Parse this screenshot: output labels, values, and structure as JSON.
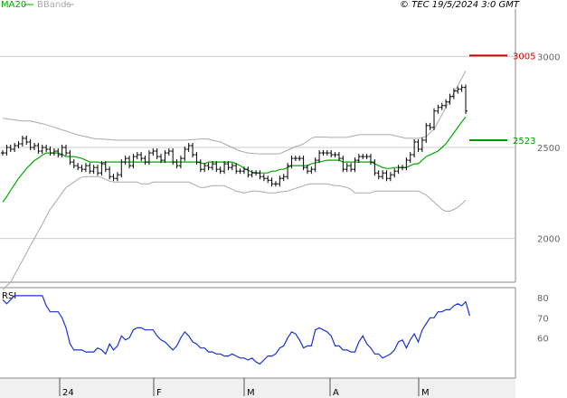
{
  "header": {
    "ma_label": "MA20",
    "bb_label": "BBands",
    "timestamp": "© TEC 19/5/2024 3:0 GMT"
  },
  "indicator": {
    "label": "RSI"
  },
  "colors": {
    "price": "#000000",
    "ma": "#00aa00",
    "bbands": "#aaaaaa",
    "rsi": "#1a33cc",
    "resistance": "#cc0000",
    "support": "#009900",
    "grid": "#cccccc",
    "background": "#ffffff",
    "lower_bg": "#f2f2f2"
  },
  "chart_data": {
    "type": "ohlc",
    "price_axis": {
      "ticks": [
        2000,
        2500,
        3000
      ],
      "tick_labels": [
        "2000",
        "2500",
        "3000"
      ],
      "ylim": [
        1760,
        3260
      ]
    },
    "rsi_axis": {
      "ticks": [
        60,
        70,
        80
      ],
      "tick_labels": [
        "60",
        "70",
        "80"
      ],
      "ylim": [
        40,
        85
      ]
    },
    "x_labels": [
      "24",
      "F",
      "M",
      "A",
      "M"
    ],
    "levels": [
      {
        "label": "3005",
        "value": 3005,
        "color": "#cc0000"
      },
      {
        "label": "2523",
        "value": 2540,
        "color": "#009900"
      }
    ],
    "close": [
      2470,
      2500,
      2490,
      2510,
      2520,
      2550,
      2530,
      2500,
      2510,
      2480,
      2500,
      2490,
      2470,
      2480,
      2460,
      2500,
      2470,
      2420,
      2400,
      2390,
      2380,
      2400,
      2370,
      2390,
      2360,
      2410,
      2380,
      2340,
      2330,
      2350,
      2420,
      2440,
      2400,
      2450,
      2460,
      2440,
      2420,
      2470,
      2480,
      2450,
      2430,
      2470,
      2480,
      2420,
      2400,
      2440,
      2490,
      2510,
      2460,
      2420,
      2380,
      2400,
      2390,
      2410,
      2380,
      2370,
      2410,
      2390,
      2400,
      2370,
      2370,
      2380,
      2350,
      2360,
      2360,
      2340,
      2330,
      2320,
      2300,
      2300,
      2330,
      2340,
      2400,
      2440,
      2440,
      2440,
      2390,
      2370,
      2380,
      2430,
      2470,
      2470,
      2470,
      2460,
      2460,
      2440,
      2380,
      2400,
      2380,
      2430,
      2450,
      2450,
      2450,
      2420,
      2360,
      2340,
      2360,
      2330,
      2350,
      2370,
      2390,
      2390,
      2430,
      2460,
      2530,
      2490,
      2540,
      2620,
      2610,
      2700,
      2720,
      2730,
      2750,
      2780,
      2810,
      2820,
      2830,
      2700
    ],
    "ma20": [
      2200,
      2230,
      2265,
      2297,
      2330,
      2357,
      2385,
      2405,
      2428,
      2442,
      2458,
      2470,
      2470,
      2470,
      2470,
      2463,
      2450,
      2450,
      2450,
      2445,
      2440,
      2430,
      2420,
      2420,
      2420,
      2415,
      2420,
      2420,
      2420,
      2420,
      2420,
      2420,
      2420,
      2420,
      2420,
      2420,
      2420,
      2420,
      2420,
      2420,
      2420,
      2420,
      2420,
      2420,
      2420,
      2420,
      2420,
      2420,
      2420,
      2420,
      2415,
      2410,
      2420,
      2420,
      2420,
      2420,
      2420,
      2420,
      2420,
      2410,
      2400,
      2385,
      2375,
      2365,
      2360,
      2360,
      2360,
      2360,
      2370,
      2370,
      2380,
      2380,
      2390,
      2400,
      2400,
      2400,
      2400,
      2400,
      2410,
      2415,
      2420,
      2425,
      2430,
      2430,
      2430,
      2430,
      2420,
      2420,
      2420,
      2420,
      2420,
      2420,
      2420,
      2420,
      2410,
      2400,
      2390,
      2385,
      2385,
      2390,
      2390,
      2390,
      2390,
      2400,
      2410,
      2410,
      2430,
      2450,
      2460,
      2470,
      2480,
      2500,
      2520,
      2550,
      2580,
      2610,
      2640,
      2668
    ],
    "bb_upper": [
      2660,
      2657,
      2654,
      2651,
      2648,
      2645,
      2645,
      2645,
      2640,
      2635,
      2630,
      2625,
      2618,
      2611,
      2604,
      2597,
      2590,
      2583,
      2576,
      2569,
      2564,
      2559,
      2554,
      2549,
      2547,
      2546,
      2545,
      2543,
      2541,
      2540,
      2540,
      2540,
      2540,
      2540,
      2540,
      2540,
      2540,
      2540,
      2540,
      2540,
      2540,
      2540,
      2540,
      2540,
      2540,
      2540,
      2540,
      2542,
      2544,
      2545,
      2547,
      2547,
      2546,
      2540,
      2535,
      2530,
      2520,
      2510,
      2500,
      2490,
      2480,
      2475,
      2470,
      2468,
      2466,
      2465,
      2465,
      2465,
      2465,
      2465,
      2466,
      2475,
      2485,
      2495,
      2505,
      2510,
      2520,
      2535,
      2550,
      2557,
      2557,
      2557,
      2556,
      2555,
      2555,
      2555,
      2555,
      2555,
      2560,
      2565,
      2570,
      2570,
      2570,
      2570,
      2570,
      2570,
      2570,
      2570,
      2570,
      2565,
      2560,
      2555,
      2550,
      2550,
      2550,
      2550,
      2555,
      2560,
      2580,
      2600,
      2640,
      2680,
      2720,
      2760,
      2800,
      2840,
      2880,
      2920
    ],
    "bb_lower": [
      1720,
      1740,
      1760,
      1800,
      1840,
      1880,
      1920,
      1960,
      2000,
      2040,
      2080,
      2120,
      2160,
      2190,
      2220,
      2250,
      2280,
      2295,
      2310,
      2325,
      2337,
      2340,
      2340,
      2340,
      2340,
      2335,
      2325,
      2315,
      2310,
      2310,
      2310,
      2310,
      2310,
      2310,
      2310,
      2300,
      2300,
      2300,
      2310,
      2310,
      2310,
      2310,
      2310,
      2310,
      2310,
      2310,
      2310,
      2310,
      2300,
      2290,
      2280,
      2280,
      2285,
      2290,
      2290,
      2290,
      2290,
      2280,
      2270,
      2260,
      2255,
      2250,
      2255,
      2260,
      2260,
      2258,
      2255,
      2250,
      2250,
      2250,
      2255,
      2258,
      2260,
      2268,
      2275,
      2282,
      2290,
      2297,
      2300,
      2300,
      2300,
      2300,
      2300,
      2295,
      2290,
      2290,
      2285,
      2280,
      2270,
      2250,
      2250,
      2250,
      2250,
      2250,
      2260,
      2260,
      2260,
      2260,
      2260,
      2260,
      2260,
      2260,
      2260,
      2260,
      2260,
      2260,
      2250,
      2240,
      2220,
      2200,
      2180,
      2160,
      2150,
      2150,
      2160,
      2170,
      2190,
      2210
    ],
    "rsi": [
      79,
      77,
      79,
      81,
      81,
      81,
      81,
      81,
      81,
      81,
      81,
      76,
      73,
      73,
      73,
      70,
      65,
      57,
      54,
      54,
      54,
      53,
      53,
      53,
      55,
      54,
      52,
      57,
      54,
      56,
      61,
      59,
      60,
      64,
      65,
      65,
      64,
      64,
      64,
      61,
      59,
      58,
      56,
      54,
      56,
      60,
      63,
      61,
      58,
      57,
      55,
      55,
      53,
      53,
      52,
      52,
      51,
      51,
      52,
      51,
      50,
      50,
      49,
      50,
      48,
      47,
      49,
      51,
      51,
      52,
      55,
      56,
      60,
      63,
      62,
      59,
      55,
      56,
      56,
      64,
      65,
      64,
      63,
      61,
      56,
      56,
      54,
      54,
      53,
      53,
      58,
      61,
      57,
      55,
      52,
      52,
      50,
      51,
      52,
      54,
      58,
      59,
      55,
      59,
      62,
      58,
      64,
      67,
      70,
      70,
      73,
      73,
      74,
      74,
      76,
      77,
      76,
      78,
      71
    ],
    "ohlc_spread": 30
  }
}
